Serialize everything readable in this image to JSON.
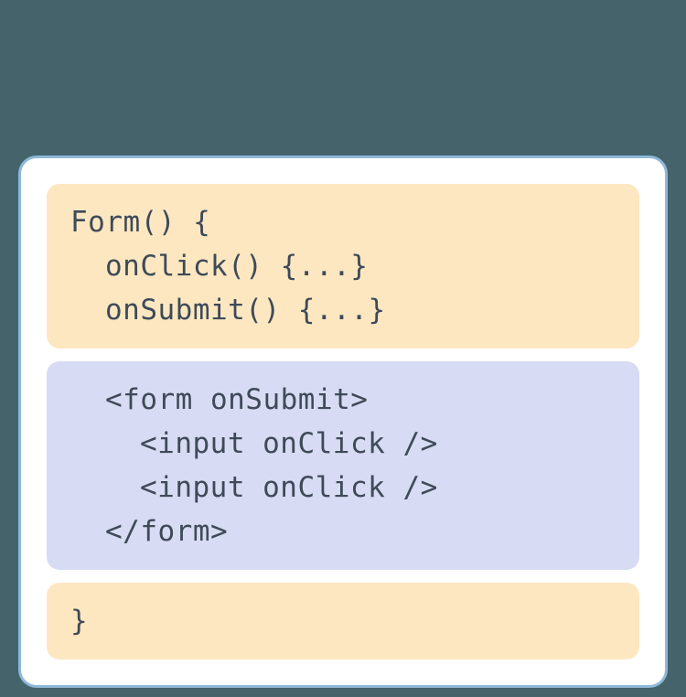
{
  "card": {
    "block1": {
      "line1": "Form() {",
      "line2": "onClick() {...}",
      "line3": "onSubmit() {...}"
    },
    "block2": {
      "line1": "<form onSubmit>",
      "line2": "<input onClick />",
      "line3": "<input onClick />",
      "line4": "</form>"
    },
    "block3": {
      "line1": "}"
    }
  },
  "colors": {
    "background": "#44636b",
    "cardBg": "#ffffff",
    "cardBorder": "#8db8d8",
    "orangeBlock": "#fde7c1",
    "purpleBlock": "#d7dbf3",
    "textColor": "#3e4a58"
  }
}
